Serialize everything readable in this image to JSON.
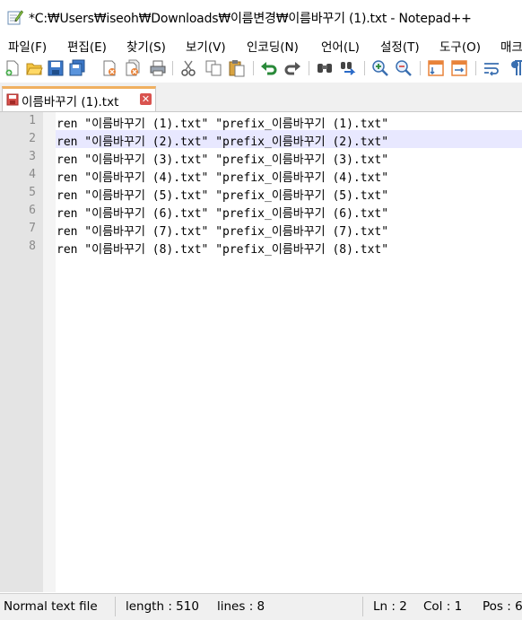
{
  "window": {
    "title": "*C:₩Users₩iseoh₩Downloads₩이름변경₩이름바꾸기 (1).txt - Notepad++",
    "app_icon": "notepad-pen-icon"
  },
  "menu": {
    "items": [
      {
        "label": "파일(F)"
      },
      {
        "label": "편집(E)"
      },
      {
        "label": "찾기(S)"
      },
      {
        "label": "보기(V)"
      },
      {
        "label": "인코딩(N)"
      },
      {
        "label": "언어(L)"
      },
      {
        "label": "설정(T)"
      },
      {
        "label": "도구(O)"
      },
      {
        "label": "매크"
      }
    ]
  },
  "toolbar": {
    "buttons": [
      "new-file-icon",
      "open-file-icon",
      "save-icon",
      "save-all-icon",
      "close-icon",
      "close-all-icon",
      "print-icon",
      "cut-icon",
      "copy-icon",
      "paste-icon",
      "undo-icon",
      "redo-icon",
      "find-icon",
      "replace-icon",
      "zoom-in-icon",
      "zoom-out-icon",
      "sync-vertical-icon",
      "sync-horizontal-icon",
      "word-wrap-icon",
      "show-all-chars-icon"
    ]
  },
  "tab": {
    "label": "이름바꾸기 (1).txt",
    "icon": "unsaved-file-icon",
    "close_icon": "close-tab-icon",
    "close_glyph": "✕"
  },
  "editor": {
    "current_line": 2,
    "lines": [
      {
        "num": "1",
        "text": "ren \"이름바꾸기 (1).txt\" \"prefix_이름바꾸기 (1).txt\""
      },
      {
        "num": "2",
        "text": "ren \"이름바꾸기 (2).txt\" \"prefix_이름바꾸기 (2).txt\""
      },
      {
        "num": "3",
        "text": "ren \"이름바꾸기 (3).txt\" \"prefix_이름바꾸기 (3).txt\""
      },
      {
        "num": "4",
        "text": "ren \"이름바꾸기 (4).txt\" \"prefix_이름바꾸기 (4).txt\""
      },
      {
        "num": "5",
        "text": "ren \"이름바꾸기 (5).txt\" \"prefix_이름바꾸기 (5).txt\""
      },
      {
        "num": "6",
        "text": "ren \"이름바꾸기 (6).txt\" \"prefix_이름바꾸기 (6).txt\""
      },
      {
        "num": "7",
        "text": "ren \"이름바꾸기 (7).txt\" \"prefix_이름바꾸기 (7).txt\""
      },
      {
        "num": "8",
        "text": "ren \"이름바꾸기 (8).txt\" \"prefix_이름바꾸기 (8).txt\""
      }
    ]
  },
  "status": {
    "file_type": "Normal text file",
    "length": "length : 510",
    "lines": "lines : 8",
    "ln": "Ln : 2",
    "col": "Col : 1",
    "pos": "Pos : 6"
  },
  "colors": {
    "current_line_bg": "#e8e8ff",
    "gutter_bg": "#e4e4e4",
    "tab_accent": "#f0b060",
    "close_red": "#d9534f"
  }
}
